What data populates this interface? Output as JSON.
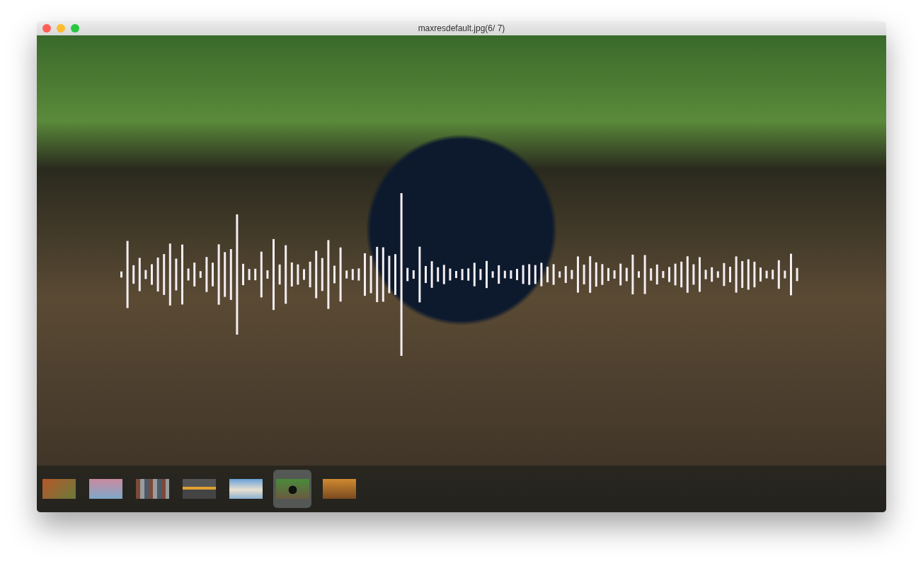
{
  "window": {
    "title": "maxresdefault.jpg(6/ 7)"
  },
  "thumbnails": [
    {
      "selected": false
    },
    {
      "selected": false
    },
    {
      "selected": false
    },
    {
      "selected": false
    },
    {
      "selected": false
    },
    {
      "selected": true
    },
    {
      "selected": false
    }
  ]
}
